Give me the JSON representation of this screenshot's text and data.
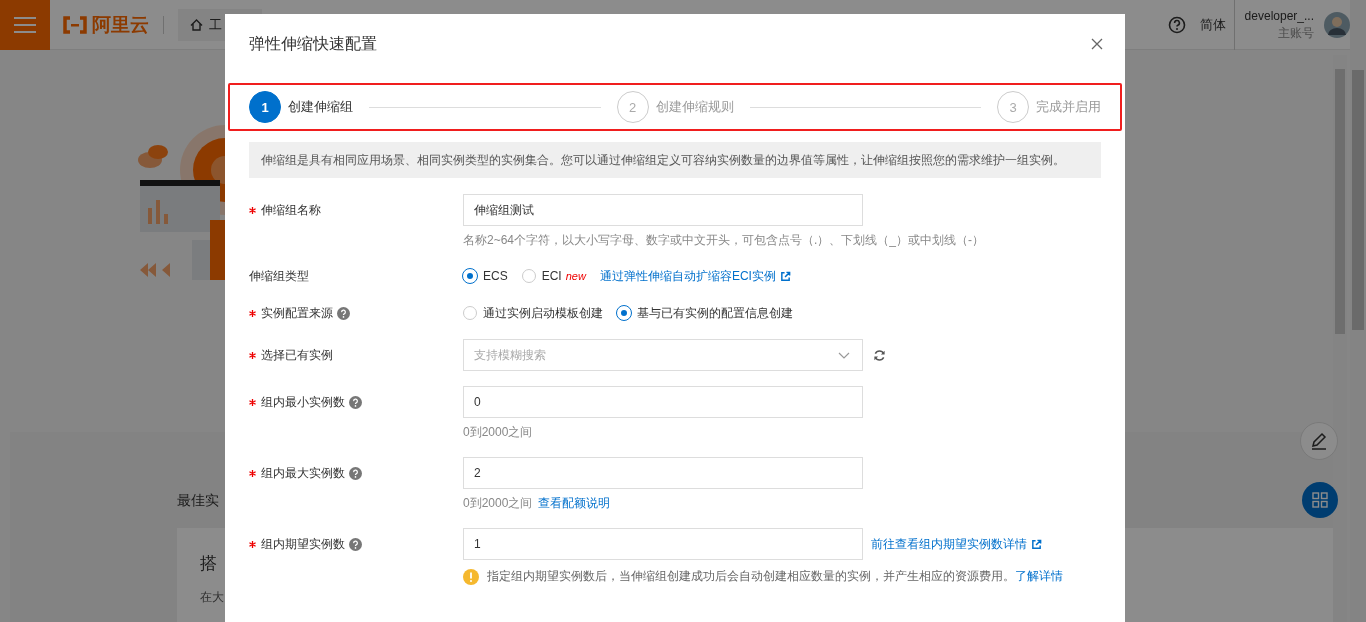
{
  "topbar": {
    "logo": "阿里云",
    "breadcrumb": "工",
    "language": "简体",
    "user": {
      "name": "developer_...",
      "role": "主账号"
    }
  },
  "background": {
    "section_title": "最佳实",
    "card": {
      "title": "搭",
      "text": "在大"
    }
  },
  "modal": {
    "title": "弹性伸缩快速配置",
    "steps": [
      {
        "number": "1",
        "label": "创建伸缩组",
        "selected": true
      },
      {
        "number": "2",
        "label": "创建伸缩规则",
        "selected": false
      },
      {
        "number": "3",
        "label": "完成并启用",
        "selected": false
      }
    ],
    "notice": "伸缩组是具有相同应用场景、相同实例类型的实例集合。您可以通过伸缩组定义可容纳实例数量的边界值等属性，让伸缩组按照您的需求维护一组实例。",
    "fields": [
      {
        "kind": "input",
        "label": "伸缩组名称",
        "required": true,
        "help": false,
        "value": "伸缩组测试",
        "hint": "名称2~64个字符，以大小写字母、数字或中文开头，可包含点号（.）、下划线（_）或中划线（-）"
      },
      {
        "kind": "radio",
        "label": "伸缩组类型",
        "required": false,
        "help": false,
        "options": [
          {
            "label": "ECS",
            "selected": true
          },
          {
            "label": "ECI",
            "selected": false,
            "badge": "new"
          }
        ],
        "link": "通过弹性伸缩自动扩缩容ECI实例"
      },
      {
        "kind": "radio",
        "label": "实例配置来源",
        "required": true,
        "help": true,
        "options": [
          {
            "label": "通过实例启动模板创建",
            "selected": false
          },
          {
            "label": "基与已有实例的配置信息创建",
            "selected": true
          }
        ]
      },
      {
        "kind": "select",
        "label": "选择已有实例",
        "required": true,
        "help": false,
        "placeholder": "支持模糊搜索"
      },
      {
        "kind": "input",
        "label": "组内最小实例数",
        "required": true,
        "help": true,
        "value": "0",
        "hint": "0到2000之间"
      },
      {
        "kind": "input",
        "label": "组内最大实例数",
        "required": true,
        "help": true,
        "value": "2",
        "hint": "0到2000之间",
        "hint_link": "查看配额说明"
      },
      {
        "kind": "input",
        "label": "组内期望实例数",
        "required": true,
        "help": true,
        "value": "1",
        "side_link": "前往查看组内期望实例数详情",
        "warning": {
          "text": "指定组内期望实例数后，当伸缩组创建成功后会自动创建相应数量的实例，并产生相应的资源费用。",
          "link": "了解详情"
        }
      }
    ]
  }
}
